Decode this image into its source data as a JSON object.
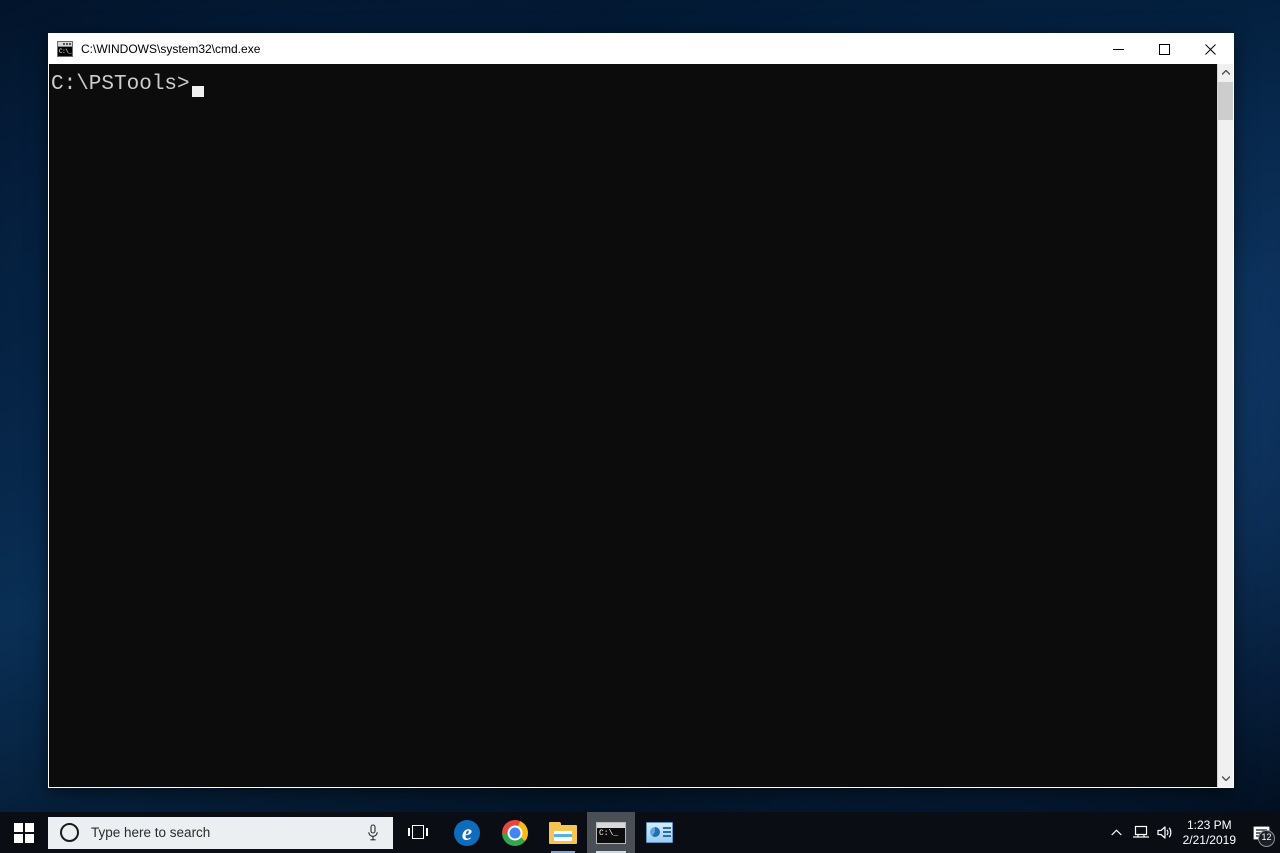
{
  "window": {
    "title": "C:\\WINDOWS\\system32\\cmd.exe",
    "icon": "cmd-icon",
    "icon_text": "C:\\_",
    "controls": {
      "minimize": "minimize-button",
      "maximize": "maximize-button",
      "close": "close-button"
    }
  },
  "console": {
    "prompt": "C:\\PSTools>",
    "cursor": "block-cursor",
    "background_color": "#0c0c0c",
    "text_color": "#cccccc"
  },
  "scrollbar": {
    "up_arrow": "scroll-up-arrow",
    "down_arrow": "scroll-down-arrow",
    "thumb": "scroll-thumb"
  },
  "taskbar": {
    "start": {
      "label": "Start",
      "icon": "windows-logo-icon"
    },
    "search": {
      "placeholder": "Type here to search",
      "cortana_icon": "cortana-circle-icon",
      "mic_icon": "microphone-icon"
    },
    "task_view": {
      "icon": "task-view-icon",
      "label": "Task View"
    },
    "apps": [
      {
        "name": "Microsoft Edge",
        "icon": "edge-icon",
        "glyph": "e",
        "active": false,
        "running": false
      },
      {
        "name": "Google Chrome",
        "icon": "chrome-icon",
        "active": false,
        "running": false
      },
      {
        "name": "File Explorer",
        "icon": "file-explorer-icon",
        "active": false,
        "running": true
      },
      {
        "name": "Command Prompt",
        "icon": "cmd-icon",
        "icon_text": "C:\\_",
        "active": true,
        "running": true
      },
      {
        "name": "Remote Desktop",
        "icon": "remote-desktop-icon",
        "active": false,
        "running": false
      }
    ],
    "tray": {
      "show_hidden_icon": "chevron-up-icon",
      "network_icon": "network-icon",
      "volume_icon": "volume-icon",
      "time": "1:23 PM",
      "date": "2/21/2019",
      "notifications_icon": "action-center-icon",
      "notifications_count": "12"
    }
  },
  "desktop": {
    "background_color": "#04203f"
  }
}
